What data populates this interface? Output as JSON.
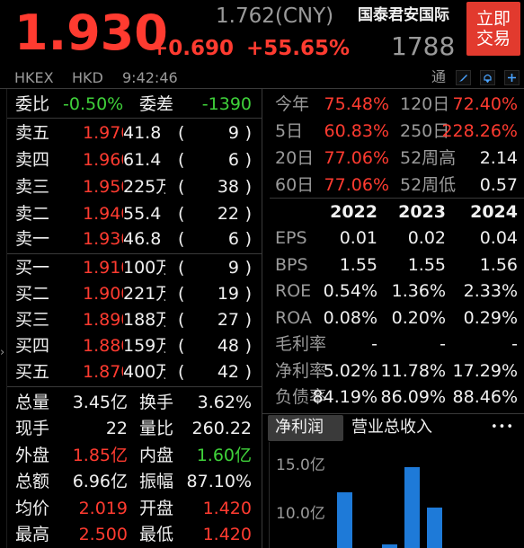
{
  "header": {
    "price": "1.930",
    "change": "+0.690",
    "change_pct": "+55.65%",
    "ref_price": "1.762(CNY)",
    "name": "国泰君安国际",
    "code": "1788",
    "trade_button": "立即交易",
    "exchange": "HKEX",
    "currency": "HKD",
    "time": "9:42:46",
    "tong_label": "通"
  },
  "order_book": {
    "wei_bi_label": "委比",
    "wei_bi_value": "-0.50%",
    "wei_cha_label": "委差",
    "wei_cha_value": "-1390",
    "asks": [
      {
        "label": "卖五",
        "price": "1.970",
        "volume": "41.8",
        "count": "9"
      },
      {
        "label": "卖四",
        "price": "1.960",
        "volume": "61.4",
        "count": "6"
      },
      {
        "label": "卖三",
        "price": "1.950",
        "volume": "225万",
        "count": "38"
      },
      {
        "label": "卖二",
        "price": "1.940",
        "volume": "55.4",
        "count": "22"
      },
      {
        "label": "卖一",
        "price": "1.930",
        "volume": "46.8",
        "count": "6"
      }
    ],
    "bids": [
      {
        "label": "买一",
        "price": "1.910",
        "volume": "100万",
        "count": "9"
      },
      {
        "label": "买二",
        "price": "1.900",
        "volume": "221万",
        "count": "19"
      },
      {
        "label": "买三",
        "price": "1.890",
        "volume": "188万",
        "count": "27"
      },
      {
        "label": "买四",
        "price": "1.880",
        "volume": "159万",
        "count": "48"
      },
      {
        "label": "买五",
        "price": "1.870",
        "volume": "400万",
        "count": "42"
      }
    ]
  },
  "stats": [
    {
      "l1": "总量",
      "v1": "3.45亿",
      "l2": "换手",
      "v2": "3.62%",
      "c1": "white",
      "c2": "white"
    },
    {
      "l1": "现手",
      "v1": "22",
      "l2": "量比",
      "v2": "260.22",
      "c1": "white",
      "c2": "white"
    },
    {
      "l1": "外盘",
      "v1": "1.85亿",
      "l2": "内盘",
      "v2": "1.60亿",
      "c1": "red",
      "c2": "green"
    },
    {
      "l1": "总额",
      "v1": "6.96亿",
      "l2": "振幅",
      "v2": "87.10%",
      "c1": "white",
      "c2": "white"
    },
    {
      "l1": "均价",
      "v1": "2.019",
      "l2": "开盘",
      "v2": "1.420",
      "c1": "red",
      "c2": "red"
    },
    {
      "l1": "最高",
      "v1": "2.500",
      "l2": "最低",
      "v2": "1.420",
      "c1": "red",
      "c2": "red"
    }
  ],
  "performance": [
    {
      "l1": "今年",
      "v1": "75.48%",
      "l2": "120日",
      "v2": "72.40%",
      "c2": "red"
    },
    {
      "l1": "5日",
      "v1": "60.83%",
      "l2": "250日",
      "v2": "228.26%",
      "c2": "red"
    },
    {
      "l1": "20日",
      "v1": "77.06%",
      "l2": "52周高",
      "v2": "2.14",
      "c2": "white"
    },
    {
      "l1": "60日",
      "v1": "77.06%",
      "l2": "52周低",
      "v2": "0.57",
      "c2": "white"
    }
  ],
  "financials": {
    "years": [
      "2022",
      "2023",
      "2024"
    ],
    "rows": [
      {
        "label": "EPS",
        "values": [
          "0.01",
          "0.02",
          "0.04"
        ]
      },
      {
        "label": "BPS",
        "values": [
          "1.55",
          "1.55",
          "1.56"
        ]
      },
      {
        "label": "ROE",
        "values": [
          "0.54%",
          "1.36%",
          "2.33%"
        ]
      },
      {
        "label": "ROA",
        "values": [
          "0.08%",
          "0.20%",
          "0.29%"
        ]
      },
      {
        "label": "毛利率",
        "values": [
          "-",
          "-",
          "-"
        ]
      },
      {
        "label": "净利率",
        "values": [
          "5.02%",
          "11.78%",
          "17.29%"
        ]
      },
      {
        "label": "负债率",
        "values": [
          "84.19%",
          "86.09%",
          "88.46%"
        ]
      }
    ]
  },
  "chart_tabs": {
    "active": "净利润",
    "inactive": "营业总收入",
    "more": "•••"
  },
  "chart_data": {
    "type": "bar",
    "tick_labels": [
      "15.0亿",
      "10.0亿"
    ],
    "ticks": [
      15.0,
      10.0
    ],
    "values": [
      12.3,
      6.2,
      6.9,
      14.9,
      10.7
    ],
    "visible_min": 5.2,
    "colors": {
      "bar": "#1e7ad8"
    }
  },
  "colors": {
    "up": "#ff3b30",
    "down": "#3fd13a",
    "accent": "#e23a2e"
  }
}
